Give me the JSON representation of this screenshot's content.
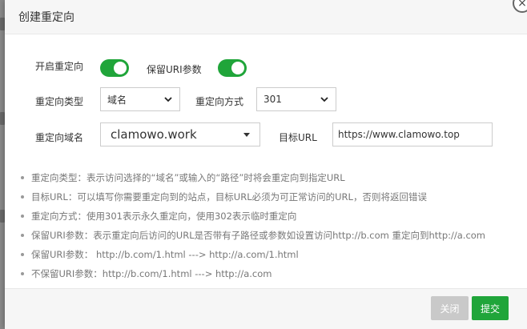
{
  "dialog": {
    "title": "创建重定向",
    "close_glyph": "×"
  },
  "form": {
    "enable_redirect_label": "开启重定向",
    "enable_redirect_on": true,
    "keep_uri_label": "保留URI参数",
    "keep_uri_on": true,
    "redirect_type_label": "重定向类型",
    "redirect_type_value": "域名",
    "redirect_method_label": "重定向方式",
    "redirect_method_value": "301",
    "redirect_domain_label": "重定向域名",
    "redirect_domain_value": "clamowo.work",
    "target_url_label": "目标URL",
    "target_url_value": "https://www.clamowo.top"
  },
  "tips": [
    "重定向类型：表示访问选择的“域名”或输入的“路径”时将会重定向到指定URL",
    "目标URL：可以填写你需要重定向到的站点，目标URL必须为可正常访问的URL，否则将返回错误",
    "重定向方式：使用301表示永久重定向，使用302表示临时重定向",
    "保留URI参数：表示重定向后访问的URL是否带有子路径或参数如设置访问http://b.com 重定向到http://a.com",
    "保留URI参数：  http://b.com/1.html ---> http://a.com/1.html",
    "不保留URI参数：http://b.com/1.html ---> http://a.com"
  ],
  "footer": {
    "close_label": "关闭",
    "submit_label": "提交"
  },
  "colors": {
    "accent": "#20a53a",
    "disabled": "#c9c9c9"
  }
}
